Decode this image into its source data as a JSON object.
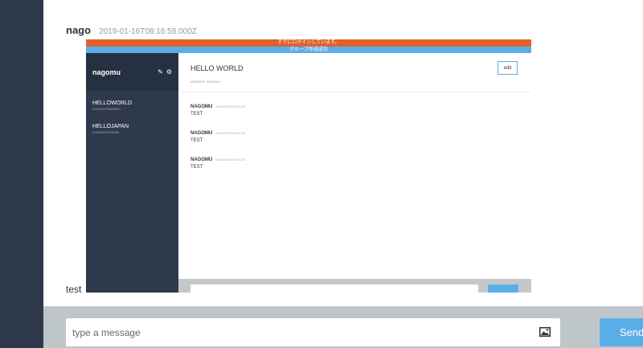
{
  "colors": {
    "sidebar": "#2e3a4b",
    "accent": "#5aaee8",
    "alert": "#e0612c",
    "form_bar": "#bfc6c9"
  },
  "messages": [
    {
      "user": "nago",
      "time": "2019-01-16T08:16:58.000Z",
      "image": {
        "alert_login": "すでにログインしています。",
        "alert_group": "グループ作成成功",
        "sidebar": {
          "user": "nagomu",
          "icons": [
            "edit-icon",
            "gear-icon"
          ],
          "groups": [
            {
              "name": "HELLOWORLD",
              "sub": "GOODBYEWORLD"
            },
            {
              "name": "HELLOJAPAN",
              "sub": "GOODBYEJAPAN"
            }
          ]
        },
        "main": {
          "group_name": "HELLO WORLD",
          "member": "MEMBER: NAGOMU",
          "edit_label": "edit",
          "messages": [
            {
              "user": "NAGOMU",
              "time": "0000/00/00 00:00:00",
              "body": "TEST"
            },
            {
              "user": "NAGOMU",
              "time": "0000/00/00 00:00:00",
              "body": "TEST"
            },
            {
              "user": "NAGOMU",
              "time": "0000/00/00 00:00:00",
              "body": "TEST"
            }
          ]
        }
      }
    },
    {
      "user": "test"
    }
  ],
  "form": {
    "placeholder": "type a message",
    "image_icon": "image-icon",
    "send_label": "Send"
  }
}
